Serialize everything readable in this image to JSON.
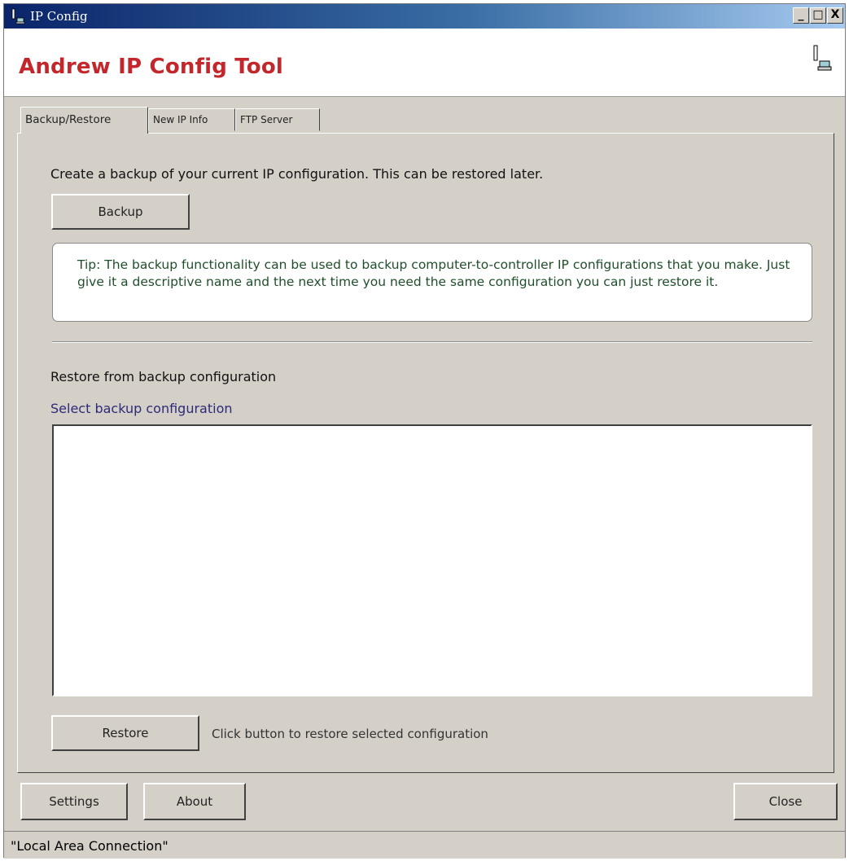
{
  "window": {
    "title": "IP Config",
    "minimize_glyph": "_",
    "maximize_glyph": "□",
    "close_glyph": "X"
  },
  "header": {
    "app_title": "Andrew IP Config Tool",
    "icon": "network-computer-icon"
  },
  "tabs": [
    {
      "label": "Backup/Restore",
      "active": true
    },
    {
      "label": "New IP Info",
      "active": false
    },
    {
      "label": "FTP Server",
      "active": false
    }
  ],
  "backup_section": {
    "description": "Create a backup of your current IP configuration. This can be restored later.",
    "backup_button": "Backup",
    "tip": "Tip: The backup functionality can be used to backup computer-to-controller IP configurations that you make.  Just give it a descriptive name and the next time you need the same configuration you can just restore it."
  },
  "restore_section": {
    "heading": "Restore from backup configuration",
    "list_label": "Select backup configuration",
    "list_items": [],
    "restore_button": "Restore",
    "hint": "Click button to restore selected configuration"
  },
  "footer": {
    "settings_button": "Settings",
    "about_button": "About",
    "close_button": "Close"
  },
  "status_bar": {
    "text": "\"Local Area Connection\""
  },
  "colors": {
    "app_title": "#c4272b",
    "tip_text": "#1f4f2a",
    "list_label": "#2e2a7a",
    "titlebar_start": "#0a246a"
  }
}
